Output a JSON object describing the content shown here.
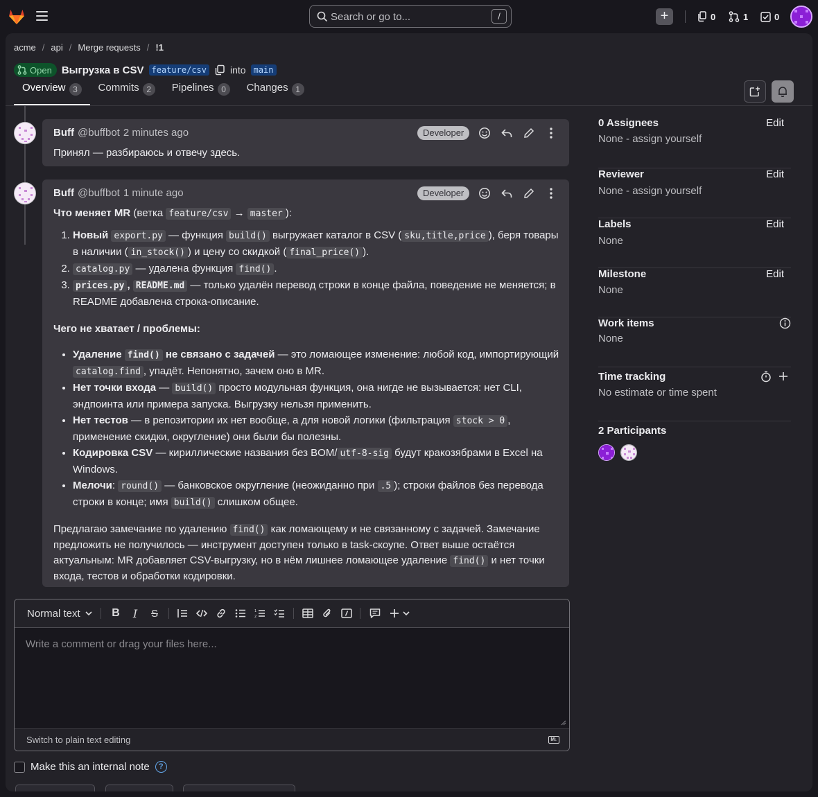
{
  "topbar": {
    "search_placeholder": "Search or go to...",
    "search_shortcut": "/",
    "issues_count": "0",
    "mr_count": "1",
    "todos_count": "0"
  },
  "breadcrumb": [
    "acme",
    "api",
    "Merge requests",
    "!1"
  ],
  "mr": {
    "status": "Open",
    "title": "Выгрузка в CSV",
    "source_branch": "feature/csv",
    "into": "into",
    "target_branch": "main"
  },
  "tabs": [
    {
      "label": "Overview",
      "count": "3"
    },
    {
      "label": "Commits",
      "count": "2"
    },
    {
      "label": "Pipelines",
      "count": "0"
    },
    {
      "label": "Changes",
      "count": "1"
    }
  ],
  "notes": [
    {
      "author": "Buff",
      "handle": "@buffbot",
      "time": "2 minutes ago",
      "role": "Developer",
      "text": "Принял — разбираюсь и отвечу здесь."
    },
    {
      "author": "Buff",
      "handle": "@buffbot",
      "time": "1 minute ago",
      "role": "Developer",
      "intro_bold": "Что меняет MR",
      "intro_a": " (ветка ",
      "intro_code1": "feature/csv",
      "intro_arrow": " → ",
      "intro_code2": "master",
      "intro_b": "):",
      "changes": {
        "i1_bold": "Новый",
        "i1_code1": "export.py",
        "i1_a": " — функция ",
        "i1_code2": "build()",
        "i1_b": " выгружает каталог в CSV (",
        "i1_code3": "sku,title,price",
        "i1_c": "), беря товары в наличии (",
        "i1_code4": "in_stock()",
        "i1_d": ") и цену со скидкой (",
        "i1_code5": "final_price()",
        "i1_e": ").",
        "i2_code1": "catalog.py",
        "i2_a": " — удалена функция ",
        "i2_code2": "find()",
        "i2_b": ".",
        "i3_code1": "prices.py",
        "i3_comma": ",",
        "i3_code2": "README.md",
        "i3_a": " — только удалён перевод строки в конце файла, поведение не меняется; в README добавлена строка-описание."
      },
      "problems_heading": "Чего не хватает / проблемы:",
      "problems": {
        "p1_bold_a": "Удаление",
        "p1_code1": "find()",
        "p1_bold_b": "не связано с задачей",
        "p1_a": " — это ломающее изменение: любой код, импортирующий ",
        "p1_code2": "catalog.find",
        "p1_b": ", упадёт. Непонятно, зачем оно в MR.",
        "p2_bold": "Нет точки входа",
        "p2_a": " — ",
        "p2_code": "build()",
        "p2_b": " просто модульная функция, она нигде не вызывается: нет CLI, эндпоинта или примера запуска. Выгрузку нельзя применить.",
        "p3_bold": "Нет тестов",
        "p3_a": " — в репозитории их нет вообще, а для новой логики (фильтрация ",
        "p3_code": "stock > 0",
        "p3_b": ", применение скидки, округление) они были бы полезны.",
        "p4_bold": "Кодировка CSV",
        "p4_a": " — кириллические названия без BOM/",
        "p4_code": "utf-8-sig",
        "p4_b": " будут кракозябрами в Excel на Windows.",
        "p5_bold": "Мелочи",
        "p5_a": ": ",
        "p5_code1": "round()",
        "p5_b": " — банковское округление (неожиданно при ",
        "p5_code2": ".5",
        "p5_c": "); строки файлов без перевода строки в конце; имя ",
        "p5_code3": "build()",
        "p5_d": " слишком общее."
      },
      "closing": {
        "a": "Предлагаю замечание по удалению ",
        "code1": "find()",
        "b": " как ломающему и не связанному с задачей. Замечание предложить не получилось — инструмент доступен только в task-скоупе. Ответ выше остаётся актуальным: MR добавляет CSV-выгрузку, но в нём лишнее ломающее удаление ",
        "code2": "find()",
        "c": " и нет точки входа, тестов и обработки кодировки."
      }
    }
  ],
  "sidebar": {
    "assignees_title": "0 Assignees",
    "assignees_value": "None - assign yourself",
    "reviewer_title": "Reviewer",
    "reviewer_value": "None - assign yourself",
    "labels_title": "Labels",
    "labels_value": "None",
    "milestone_title": "Milestone",
    "milestone_value": "None",
    "workitems_title": "Work items",
    "workitems_value": "None",
    "time_title": "Time tracking",
    "time_value": "No estimate or time spent",
    "participants_title": "2 Participants",
    "edit_label": "Edit"
  },
  "editor": {
    "format_label": "Normal text",
    "placeholder": "Write a comment or drag your files here...",
    "switch_label": "Switch to plain text editing",
    "md_label": "M↓",
    "internal_label": "Make this an internal note",
    "help_glyph": "?"
  },
  "colors": {
    "background": "#18171d",
    "panel": "#232228",
    "note": "#3a383f",
    "open_badge": "#0d532a",
    "branch": "#153d77",
    "avatar_purple": "#8b1fd6"
  }
}
